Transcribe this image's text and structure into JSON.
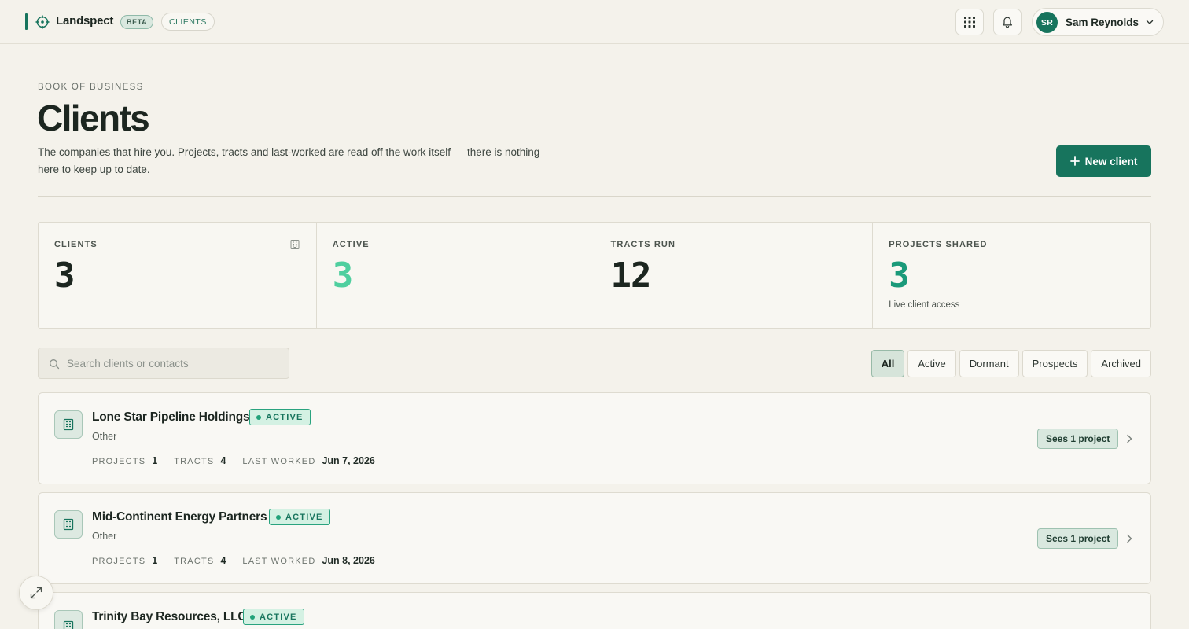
{
  "app": {
    "name": "Landspect",
    "beta_label": "BETA",
    "section_label": "CLIENTS"
  },
  "topbar": {
    "apps_icon": "grid-icon",
    "notifications_icon": "bell-icon",
    "user": {
      "initials": "SR",
      "name": "Sam Reynolds"
    }
  },
  "header": {
    "eyebrow": "BOOK OF BUSINESS",
    "title": "Clients",
    "subtitle": "The companies that hire you. Projects, tracts and last-worked are read off the work itself — there is nothing here to keep up to date.",
    "new_client_label": "New client"
  },
  "stats": [
    {
      "label": "CLIENTS",
      "value": "3",
      "color": "#1c2620",
      "note": ""
    },
    {
      "label": "ACTIVE",
      "value": "3",
      "color": "#4fcf9f",
      "note": ""
    },
    {
      "label": "TRACTS RUN",
      "value": "12",
      "color": "#1c2620",
      "note": ""
    },
    {
      "label": "PROJECTS SHARED",
      "value": "3",
      "color": "#1a9a7a",
      "note": "Live client access"
    }
  ],
  "search": {
    "placeholder": "Search clients or contacts",
    "value": ""
  },
  "filters": [
    {
      "label": "All",
      "selected": true
    },
    {
      "label": "Active",
      "selected": false
    },
    {
      "label": "Dormant",
      "selected": false
    },
    {
      "label": "Prospects",
      "selected": false
    },
    {
      "label": "Archived",
      "selected": false
    }
  ],
  "meta_labels": {
    "projects": "PROJECTS",
    "tracts": "TRACTS",
    "last_worked": "LAST WORKED"
  },
  "clients": [
    {
      "name": "Lone Star Pipeline Holdings",
      "status": "ACTIVE",
      "type": "Other",
      "projects": "1",
      "tracts": "4",
      "last_worked": "Jun 7, 2026",
      "access": "Sees 1 project"
    },
    {
      "name": "Mid-Continent Energy Partners",
      "status": "ACTIVE",
      "type": "Other",
      "projects": "1",
      "tracts": "4",
      "last_worked": "Jun 8, 2026",
      "access": "Sees 1 project"
    },
    {
      "name": "Trinity Bay Resources, LLC",
      "status": "ACTIVE",
      "type": "",
      "projects": "",
      "tracts": "",
      "last_worked": "",
      "access": ""
    }
  ],
  "colors": {
    "accent": "#17745d",
    "background": "#f4f2eb",
    "active_badge": "#22a27a"
  }
}
